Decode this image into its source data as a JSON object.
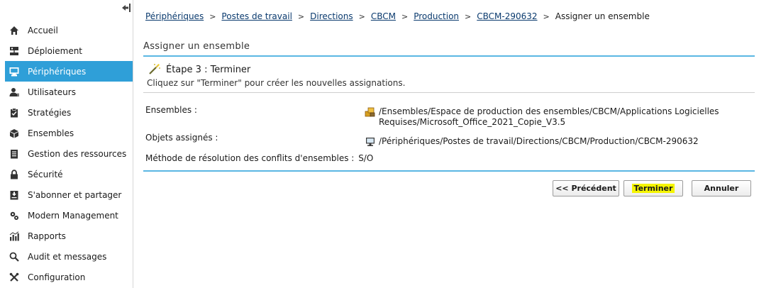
{
  "sidebar": {
    "items": [
      {
        "label": "Accueil",
        "icon": "home-icon"
      },
      {
        "label": "Déploiement",
        "icon": "deployment-icon"
      },
      {
        "label": "Périphériques",
        "icon": "monitor-icon",
        "active": true
      },
      {
        "label": "Utilisateurs",
        "icon": "users-icon"
      },
      {
        "label": "Stratégies",
        "icon": "policy-icon"
      },
      {
        "label": "Ensembles",
        "icon": "box-icon"
      },
      {
        "label": "Gestion des ressources",
        "icon": "resources-icon"
      },
      {
        "label": "Sécurité",
        "icon": "lock-icon"
      },
      {
        "label": "S'abonner et partager",
        "icon": "subscribe-icon"
      },
      {
        "label": "Modern Management",
        "icon": "cogs-icon"
      },
      {
        "label": "Rapports",
        "icon": "reports-icon"
      },
      {
        "label": "Audit et messages",
        "icon": "audit-icon"
      },
      {
        "label": "Configuration",
        "icon": "wrench-icon"
      }
    ],
    "active_color": "#2f9fd8"
  },
  "breadcrumb": {
    "links": [
      "Périphériques",
      "Postes de travail",
      "Directions",
      "CBCM",
      "Production",
      "CBCM-290632"
    ],
    "current": "Assigner un ensemble"
  },
  "panel": {
    "title": "Assigner un ensemble",
    "step_title": "Étape 3 : Terminer",
    "step_desc": "Cliquez sur \"Terminer\" pour créer les nouvelles assignations.",
    "rows": {
      "ensembles_label": "Ensembles :",
      "ensembles_value": "/Ensembles/Espace de production des ensembles/CBCM/Applications Logicielles Requises/Microsoft_Office_2021_Copie_V3.5",
      "objets_label": "Objets assignés :",
      "objets_value": "/Périphériques/Postes de travail/Directions/CBCM/Production/CBCM-290632",
      "methode_label": "Méthode de résolution des conflits d'ensembles :",
      "methode_value": "S/O"
    }
  },
  "buttons": {
    "previous": "<< Précédent",
    "finish": "Terminer",
    "cancel": "Annuler",
    "highlight_color": "#f5f500"
  }
}
